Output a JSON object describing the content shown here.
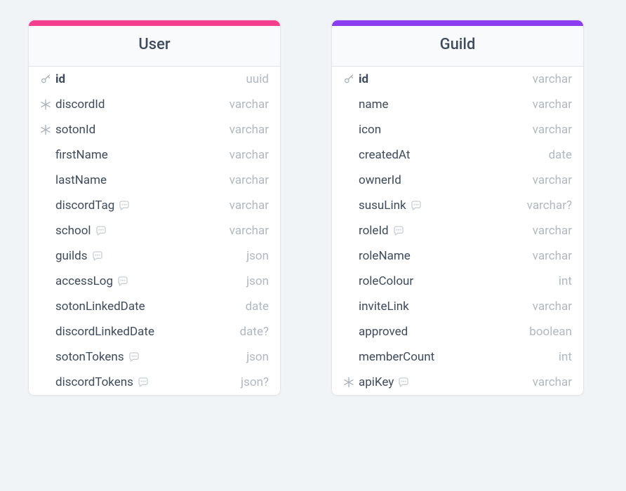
{
  "tables": [
    {
      "name": "User",
      "accent": "#f43f8e",
      "columns": [
        {
          "icon": "key",
          "name": "id",
          "type": "uuid",
          "pk": true,
          "comment": false
        },
        {
          "icon": "snow",
          "name": "discordId",
          "type": "varchar",
          "pk": false,
          "comment": false
        },
        {
          "icon": "snow",
          "name": "sotonId",
          "type": "varchar",
          "pk": false,
          "comment": false
        },
        {
          "icon": "",
          "name": "firstName",
          "type": "varchar",
          "pk": false,
          "comment": false
        },
        {
          "icon": "",
          "name": "lastName",
          "type": "varchar",
          "pk": false,
          "comment": false
        },
        {
          "icon": "",
          "name": "discordTag",
          "type": "varchar",
          "pk": false,
          "comment": true
        },
        {
          "icon": "",
          "name": "school",
          "type": "varchar",
          "pk": false,
          "comment": true
        },
        {
          "icon": "",
          "name": "guilds",
          "type": "json",
          "pk": false,
          "comment": true
        },
        {
          "icon": "",
          "name": "accessLog",
          "type": "json",
          "pk": false,
          "comment": true
        },
        {
          "icon": "",
          "name": "sotonLinkedDate",
          "type": "date",
          "pk": false,
          "comment": false
        },
        {
          "icon": "",
          "name": "discordLinkedDate",
          "type": "date?",
          "pk": false,
          "comment": false
        },
        {
          "icon": "",
          "name": "sotonTokens",
          "type": "json",
          "pk": false,
          "comment": true
        },
        {
          "icon": "",
          "name": "discordTokens",
          "type": "json?",
          "pk": false,
          "comment": true
        }
      ]
    },
    {
      "name": "Guild",
      "accent": "#8b3cf0",
      "columns": [
        {
          "icon": "key",
          "name": "id",
          "type": "varchar",
          "pk": true,
          "comment": false
        },
        {
          "icon": "",
          "name": "name",
          "type": "varchar",
          "pk": false,
          "comment": false
        },
        {
          "icon": "",
          "name": "icon",
          "type": "varchar",
          "pk": false,
          "comment": false
        },
        {
          "icon": "",
          "name": "createdAt",
          "type": "date",
          "pk": false,
          "comment": false
        },
        {
          "icon": "",
          "name": "ownerId",
          "type": "varchar",
          "pk": false,
          "comment": false
        },
        {
          "icon": "",
          "name": "susuLink",
          "type": "varchar?",
          "pk": false,
          "comment": true
        },
        {
          "icon": "",
          "name": "roleId",
          "type": "varchar",
          "pk": false,
          "comment": true
        },
        {
          "icon": "",
          "name": "roleName",
          "type": "varchar",
          "pk": false,
          "comment": false
        },
        {
          "icon": "",
          "name": "roleColour",
          "type": "int",
          "pk": false,
          "comment": false
        },
        {
          "icon": "",
          "name": "inviteLink",
          "type": "varchar",
          "pk": false,
          "comment": false
        },
        {
          "icon": "",
          "name": "approved",
          "type": "boolean",
          "pk": false,
          "comment": false
        },
        {
          "icon": "",
          "name": "memberCount",
          "type": "int",
          "pk": false,
          "comment": false
        },
        {
          "icon": "snow",
          "name": "apiKey",
          "type": "varchar",
          "pk": false,
          "comment": true
        }
      ]
    }
  ]
}
